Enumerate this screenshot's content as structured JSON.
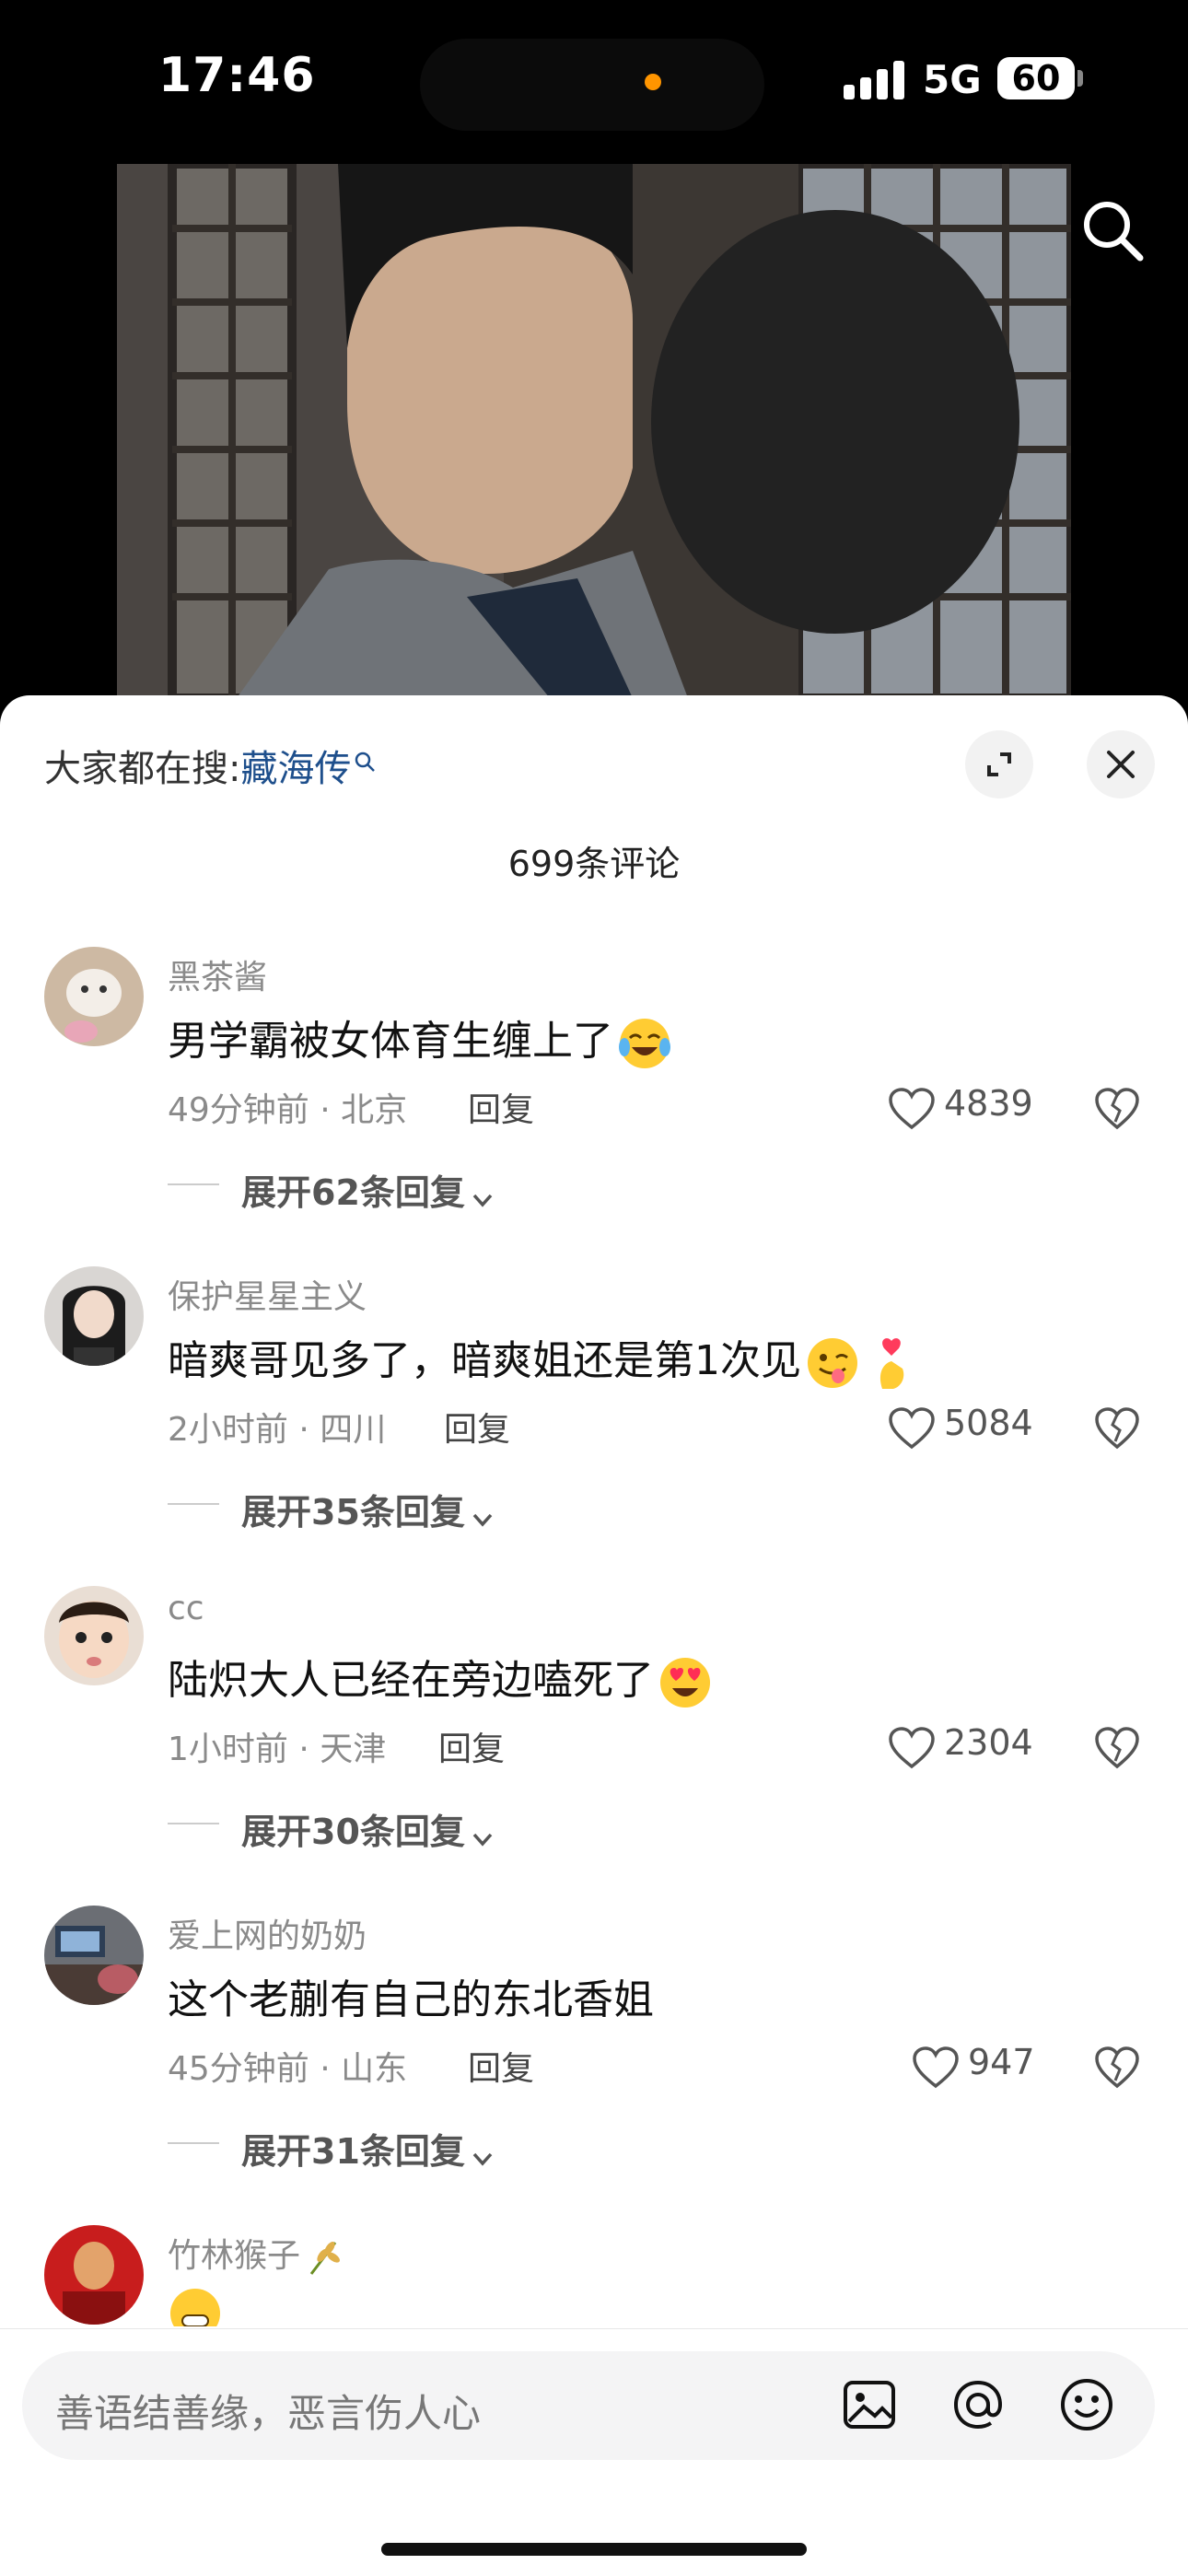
{
  "status_bar": {
    "time": "17:46",
    "network": "5G",
    "battery": "60",
    "indicator_color": "#ff9500",
    "icons": [
      "signal-icon",
      "battery-icon"
    ]
  },
  "video": {
    "icons": [
      "search-icon"
    ]
  },
  "sheet": {
    "trending_prefix": "大家都在搜:",
    "trending_keyword": "藏海传",
    "comment_count": "699条评论",
    "icons": [
      "fullscreen-icon",
      "close-icon",
      "trend-search-icon"
    ],
    "accent_color": "#1e4f8c"
  },
  "comments": [
    {
      "username": "黑茶酱",
      "text": "男学霸被女体育生缠上了",
      "emoji": "crying-laughing-emoji",
      "time": "49分钟前 · 北京",
      "reply": "回复",
      "likes": "4839",
      "expand": "展开62条回复"
    },
    {
      "username": "保护星星主义",
      "text": "暗爽哥见多了，暗爽姐还是第1次见",
      "emoji": "winking-tongue-emoji finger-heart-emoji",
      "time": "2小时前 · 四川",
      "reply": "回复",
      "likes": "5084",
      "expand": "展开35条回复"
    },
    {
      "username": "cc",
      "text": "陆炽大人已经在旁边嗑死了",
      "emoji": "heart-eyes-emoji",
      "time": "1小时前 · 天津",
      "reply": "回复",
      "likes": "2304",
      "expand": "展开30条回复"
    },
    {
      "username": "爱上网的奶奶",
      "text": "这个老蒯有自己的东北香姐",
      "time": "45分钟前 · 山东",
      "reply": "回复",
      "likes": "947",
      "expand": "展开31条回复"
    },
    {
      "username": "竹林猴子",
      "emoji": "grinning-emoji"
    }
  ],
  "input": {
    "placeholder": "善语结善缘，恶言伤人心",
    "icons": [
      "image-icon",
      "at-icon",
      "emoji-icon"
    ]
  }
}
